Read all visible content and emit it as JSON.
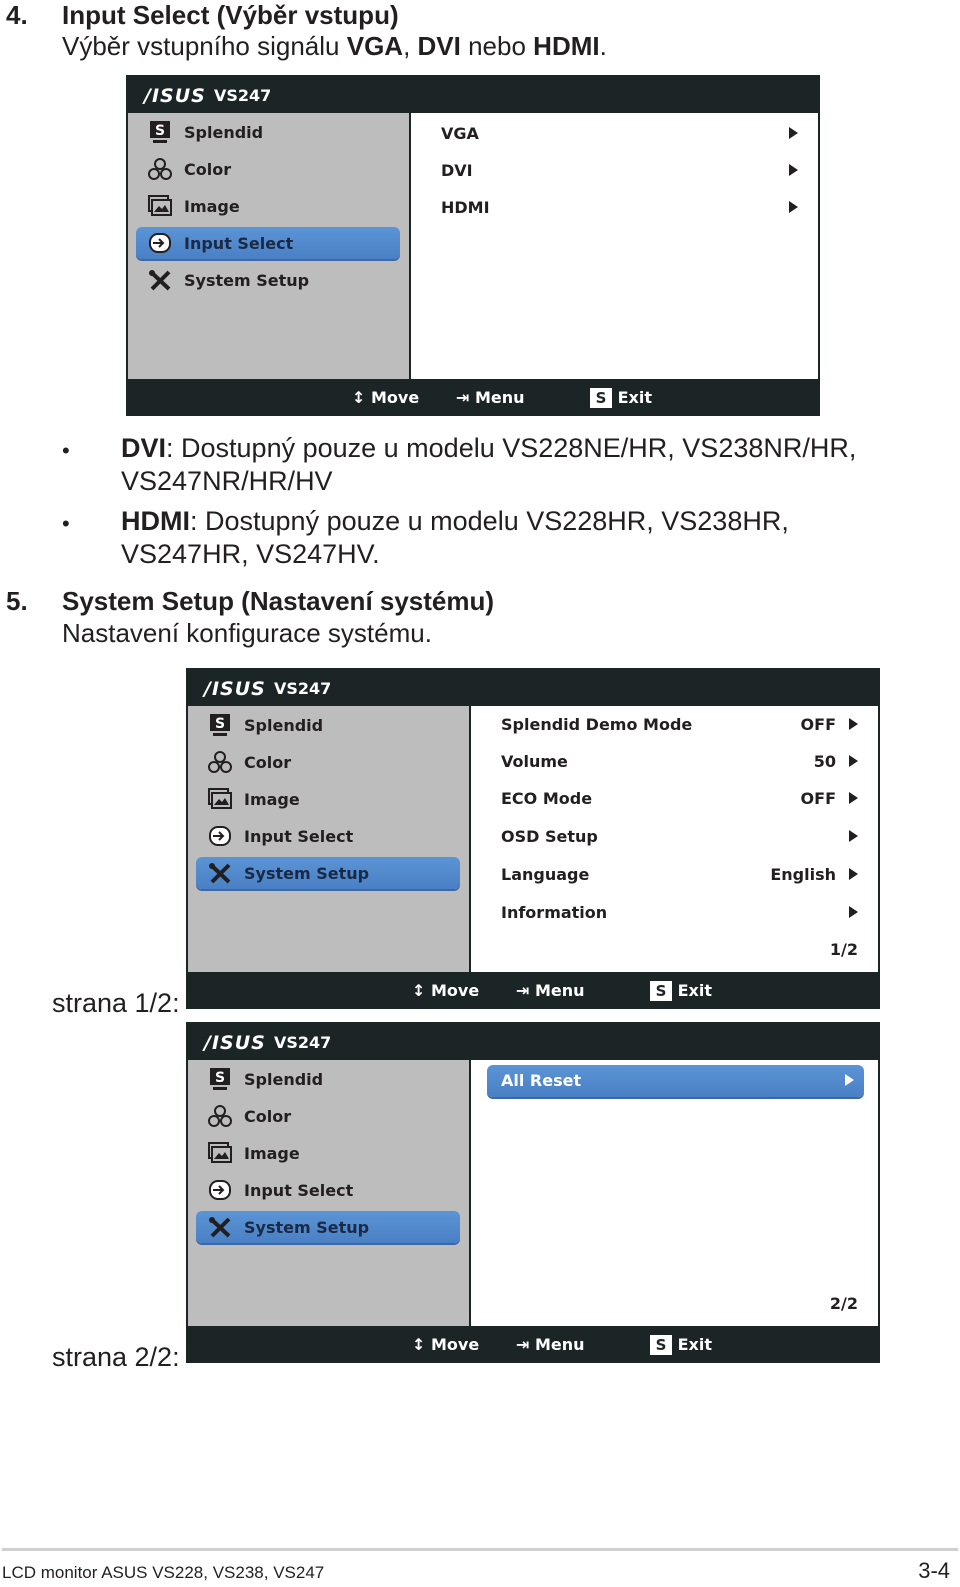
{
  "section4": {
    "number": "4.",
    "title": "Input Select (Výběr vstupu)",
    "desc_parts": [
      "Výběr vstupního signálu ",
      "VGA",
      ", ",
      "DVI",
      " nebo ",
      "HDMI",
      "."
    ]
  },
  "osd1": {
    "brand": "/ISUS",
    "model": "VS247",
    "menu": [
      {
        "label": "Splendid",
        "icon": "splendid-s-icon",
        "selected": false
      },
      {
        "label": "Color",
        "icon": "rgb-color-icon",
        "selected": false
      },
      {
        "label": "Image",
        "icon": "image-icon",
        "selected": false
      },
      {
        "label": "Input Select",
        "icon": "input-select-icon",
        "selected": true
      },
      {
        "label": "System Setup",
        "icon": "wrench-screwdriver-icon",
        "selected": false
      }
    ],
    "options": [
      {
        "label": "VGA",
        "value": ""
      },
      {
        "label": "DVI",
        "value": ""
      },
      {
        "label": "HDMI",
        "value": ""
      }
    ],
    "footer": {
      "move": "Move",
      "menu": "Menu",
      "exit": "Exit",
      "exit_key": "S"
    }
  },
  "bullets": [
    {
      "bold": "DVI",
      "text": ": Dostupný pouze u modelu VS228NE/HR, VS238NR/HR,",
      "line2": "VS247NR/HR/HV"
    },
    {
      "bold": "HDMI",
      "text": ": Dostupný pouze u modelu VS228HR, VS238HR,",
      "line2": "VS247HR, VS247HV."
    }
  ],
  "section5": {
    "number": "5.",
    "title": "System Setup (Nastavení systému)",
    "desc": "Nastavení konfigurace systému."
  },
  "osd2": {
    "side_label": "strana 1/2:",
    "brand": "/ISUS",
    "model": "VS247",
    "menu": [
      {
        "label": "Splendid"
      },
      {
        "label": "Color"
      },
      {
        "label": "Image"
      },
      {
        "label": "Input Select"
      },
      {
        "label": "System Setup",
        "selected": true
      }
    ],
    "options": [
      {
        "label": "Splendid Demo Mode",
        "value": "OFF"
      },
      {
        "label": "Volume",
        "value": "50"
      },
      {
        "label": "ECO Mode",
        "value": "OFF"
      },
      {
        "label": "OSD Setup",
        "value": ""
      },
      {
        "label": "Language",
        "value": "English"
      },
      {
        "label": "Information",
        "value": ""
      }
    ],
    "page": "1/2",
    "footer": {
      "move": "Move",
      "menu": "Menu",
      "exit": "Exit",
      "exit_key": "S"
    }
  },
  "osd3": {
    "side_label": "strana 2/2:",
    "brand": "/ISUS",
    "model": "VS247",
    "menu": [
      {
        "label": "Splendid"
      },
      {
        "label": "Color"
      },
      {
        "label": "Image"
      },
      {
        "label": "Input Select"
      },
      {
        "label": "System Setup",
        "selected": true
      }
    ],
    "options": [
      {
        "label": "All Reset",
        "value": "",
        "selected": true
      }
    ],
    "page": "2/2",
    "footer": {
      "move": "Move",
      "menu": "Menu",
      "exit": "Exit",
      "exit_key": "S"
    }
  },
  "footer": {
    "left": "LCD monitor ASUS VS228, VS238, VS247",
    "right": "3-4"
  }
}
